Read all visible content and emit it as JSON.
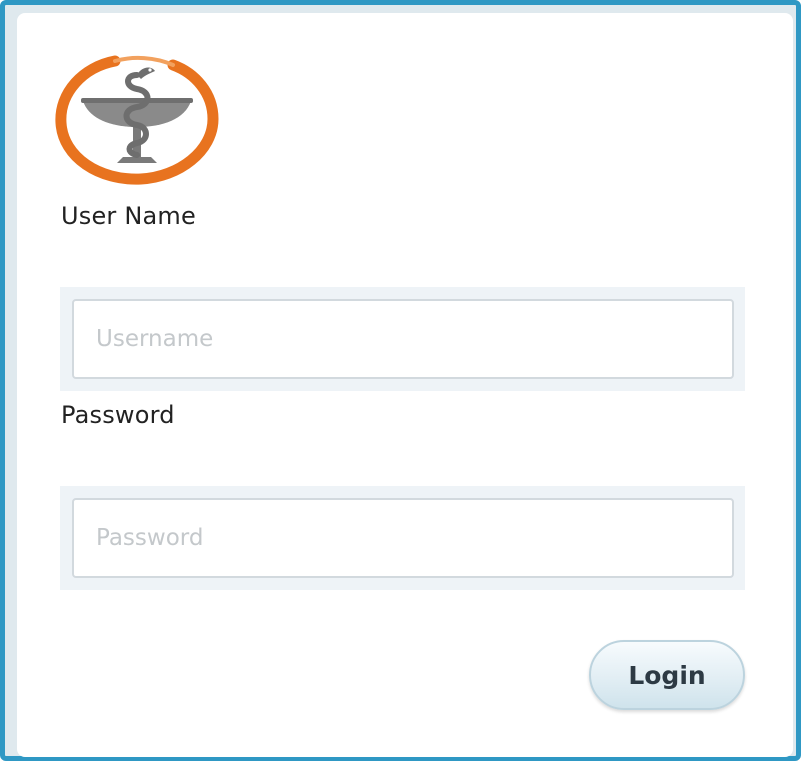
{
  "logo": {
    "icon": "pharmacy-bowl-of-hygieia-icon",
    "ring_color": "#e8731f",
    "symbol_color": "#8a8a8a"
  },
  "form": {
    "username": {
      "label": "User Name",
      "placeholder": "Username",
      "value": ""
    },
    "password": {
      "label": "Password",
      "placeholder": "Password",
      "value": ""
    },
    "login_label": "Login"
  },
  "colors": {
    "frame_border": "#2f98c4",
    "field_bg": "#eef3f7",
    "button_text": "#2d3a44"
  }
}
